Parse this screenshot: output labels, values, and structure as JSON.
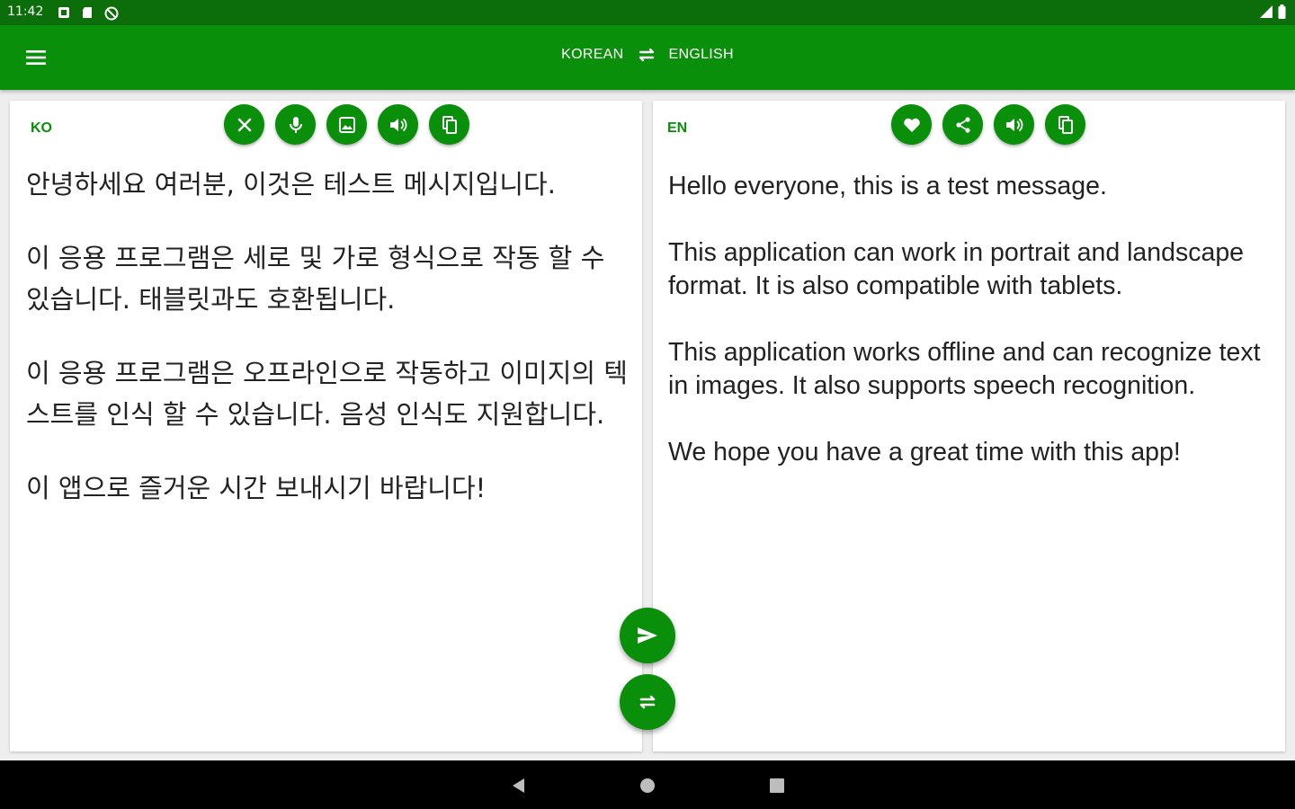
{
  "status_bar": {
    "time": "11:42",
    "left_icons": [
      "notification-icon",
      "sd-card-icon",
      "no-sync-icon"
    ],
    "right_icons": [
      "signal-icon",
      "battery-icon"
    ]
  },
  "app_bar": {
    "menu_icon": "menu-icon",
    "source_language": "KOREAN",
    "target_language": "ENGLISH",
    "swap_icon": "swap-arrows-icon"
  },
  "source_panel": {
    "lang_code": "KO",
    "tools": [
      "clear",
      "microphone",
      "image",
      "speaker",
      "copy"
    ],
    "paragraphs": [
      "안녕하세요 여러분, 이것은 테스트 메시지입니다.",
      "이 응용 프로그램은 세로 및 가로 형식으로 작동 할 수 있습니다. 태블릿과도 호환됩니다.",
      "이 응용 프로그램은 오프라인으로 작동하고 이미지의 텍스트를 인식 할 수 있습니다. 음성 인식도 지원합니다.",
      "이 앱으로 즐거운 시간 보내시기 바랍니다!"
    ]
  },
  "target_panel": {
    "lang_code": "EN",
    "tools": [
      "favorite",
      "share",
      "speaker",
      "copy"
    ],
    "paragraphs": [
      "Hello everyone, this is a test message.",
      "This application can work in portrait and landscape format. It is also compatible with tablets.",
      "This application works offline and can recognize text in images. It also supports speech recognition.",
      "We hope you have a great time with this app!"
    ]
  },
  "fabs": [
    "translate-send",
    "swap-languages"
  ],
  "nav_bar": [
    "back",
    "home",
    "recents"
  ],
  "colors": {
    "primary": "#0a8f0a",
    "status_bar": "#0b6e0b",
    "panel_bg": "#ffffff",
    "text": "#222222",
    "nav_bar": "#000000"
  }
}
